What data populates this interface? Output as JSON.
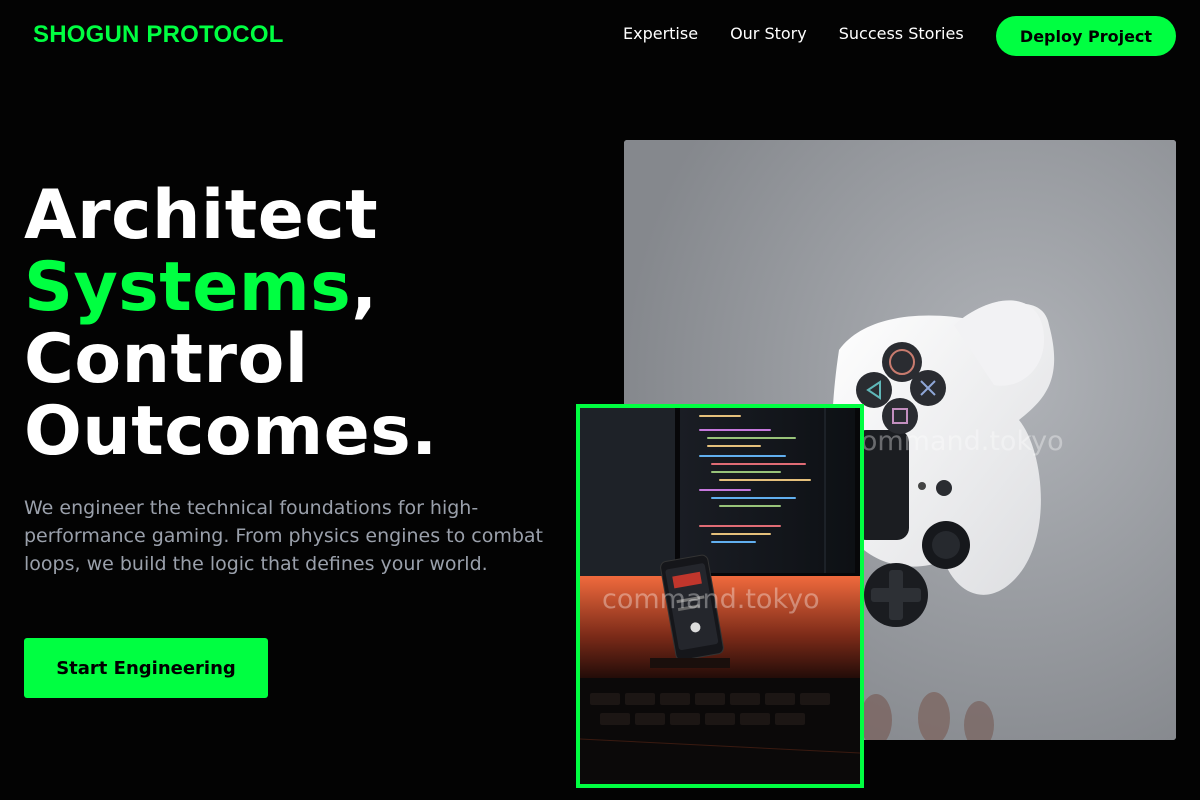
{
  "brand": {
    "name": "SHOGUN PROTOCOL"
  },
  "nav": {
    "items": [
      {
        "label": "Expertise"
      },
      {
        "label": "Our Story"
      },
      {
        "label": "Success Stories"
      }
    ],
    "cta_label": "Deploy Project"
  },
  "hero": {
    "line1": "Architect",
    "line2_accent": "Systems",
    "line2_suffix": ",",
    "line3": "Control",
    "line4": "Outcomes.",
    "description": "We engineer the technical foundations for high-performance gaming. From physics engines to combat loops, we build the logic that defines your world.",
    "cta_label": "Start Engineering"
  },
  "media": {
    "main_image_watermark": "command.tokyo",
    "inset_image_watermark": "command.tokyo"
  },
  "colors": {
    "accent": "#00ff41",
    "background": "#030303",
    "text_primary": "#ffffff",
    "text_muted": "#9aa0ab"
  }
}
